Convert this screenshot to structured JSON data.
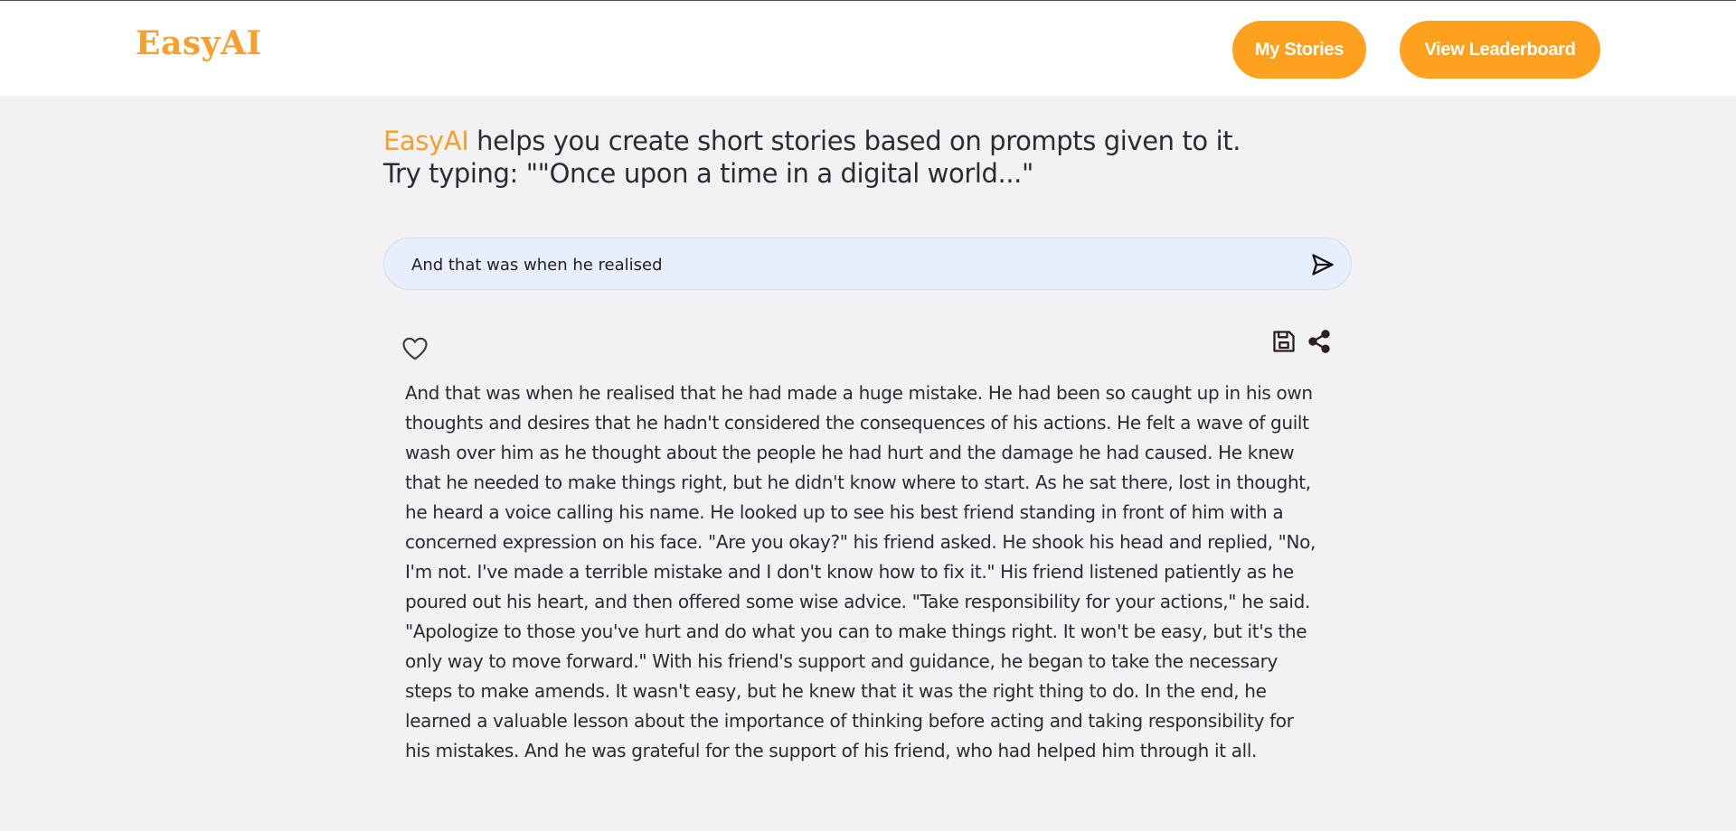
{
  "header": {
    "logo": "EasyAI",
    "my_stories_label": "My Stories",
    "leaderboard_label": "View Leaderboard"
  },
  "intro": {
    "brand": "EasyAI",
    "line1_rest": " helps you create short stories based on prompts given to it.",
    "line2": "Try typing: \"\"Once upon a time in a digital world...\""
  },
  "prompt": {
    "value": "And that was when he realised"
  },
  "story": {
    "text": "And that was when he realised that he had made a huge mistake. He had been so caught up in his own thoughts and desires that he hadn't considered the consequences of his actions. He felt a wave of guilt wash over him as he thought about the people he had hurt and the damage he had caused. He knew that he needed to make things right, but he didn't know where to start. As he sat there, lost in thought, he heard a voice calling his name. He looked up to see his best friend standing in front of him with a concerned expression on his face. \"Are you okay?\" his friend asked. He shook his head and replied, \"No, I'm not. I've made a terrible mistake and I don't know how to fix it.\" His friend listened patiently as he poured out his heart, and then offered some wise advice. \"Take responsibility for your actions,\" he said. \"Apologize to those you've hurt and do what you can to make things right. It won't be easy, but it's the only way to move forward.\" With his friend's support and guidance, he began to take the necessary steps to make amends. It wasn't easy, but he knew that it was the right thing to do. In the end, he learned a valuable lesson about the importance of thinking before acting and taking responsibility for his mistakes. And he was grateful for the support of his friend, who had helped him through it all."
  },
  "icons": {
    "send": "send-icon",
    "like": "heart-icon",
    "save": "save-icon",
    "share": "share-icon"
  },
  "colors": {
    "accent": "#f7a02b",
    "button_bg": "#fea11f",
    "background": "#f2f2f4",
    "input_bg": "#e7eefc"
  }
}
